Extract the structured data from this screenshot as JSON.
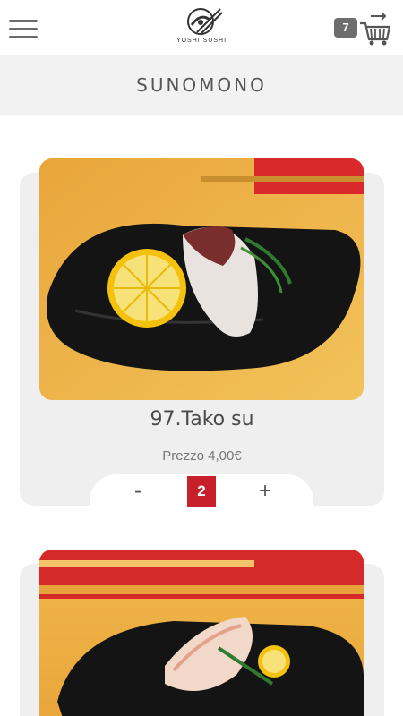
{
  "header": {
    "logo_text": "YOSHI SUSHI",
    "cart_count": "7"
  },
  "category": {
    "title": "SUNOMONO"
  },
  "products": [
    {
      "name": "97.Tako su",
      "price": "Prezzo 4,00€",
      "qty_minus": "-",
      "qty_value": "2",
      "qty_plus": "+"
    }
  ],
  "colors": {
    "accent": "#c8202a",
    "badge": "#6d6d6d",
    "card_bg": "#efefef",
    "category_bg": "#f2f2f2"
  },
  "icons": [
    "menu-icon",
    "cart-icon"
  ]
}
